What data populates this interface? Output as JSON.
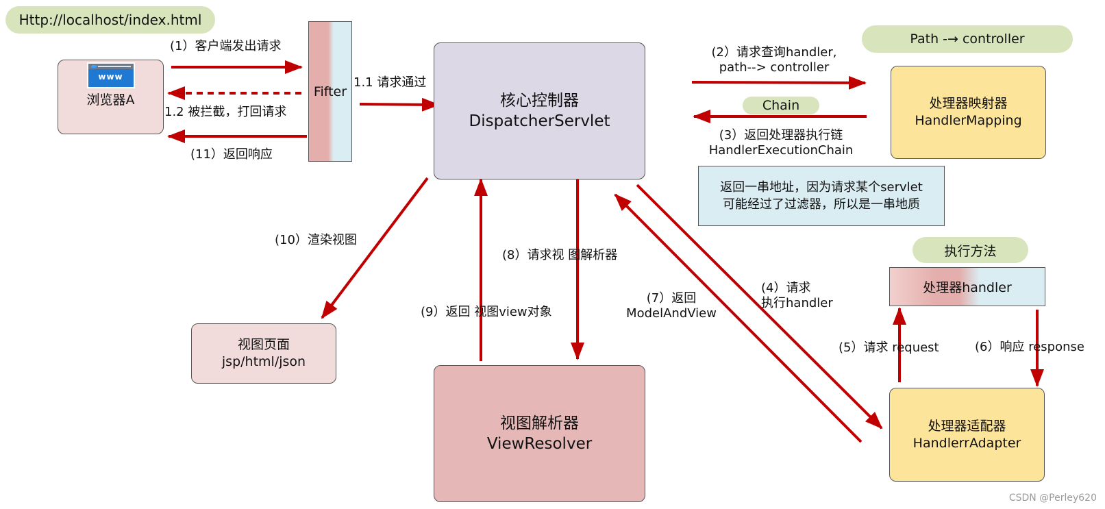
{
  "url_pill": "Http://localhost/index.html",
  "browser": {
    "label": "浏览器A",
    "icon_text": "www"
  },
  "filter": {
    "label": "Fifter"
  },
  "dispatcher": {
    "line1": "核心控制器",
    "line2": "DispatcherServlet"
  },
  "handler_mapping": {
    "line1": "处理器映射器",
    "line2": "HandlerMapping"
  },
  "path_pill": "Path -→ controller",
  "chain_pill": "Chain",
  "note": {
    "line1": "返回一串地址，因为请求某个servlet",
    "line2": "可能经过了过滤器，所以是一串地质"
  },
  "exec_pill": "执行方法",
  "handler": {
    "label": "处理器handler"
  },
  "adapter": {
    "line1": "处理器适配器",
    "line2": "HandlerrAdapter"
  },
  "view_page": {
    "line1": "视图页面",
    "line2": "jsp/html/json"
  },
  "view_resolver": {
    "line1": "视图解析器",
    "line2": "ViewResolver"
  },
  "steps": {
    "s1": "(1）客户端发出请求",
    "s1_2": "1.2 被拦截，打回请求",
    "s11": "(11）返回响应",
    "s1_1": "1.1 请求通过",
    "s2a": "(2）请求查询handler,",
    "s2b": "path--> controller",
    "s3a": "(3）返回处理器执行链",
    "s3b": "HandlerExecutionChain",
    "s4a": "(4）请求",
    "s4b": "执行handler",
    "s5": "(5）请求 request",
    "s6": "(6）响应 response",
    "s7a": "(7）返回",
    "s7b": "ModelAndView",
    "s8": "(8）请求视 图解析器",
    "s9": "(9）返回 视图view对象",
    "s10": "(10）渲染视图"
  },
  "watermark": "CSDN @Perley620",
  "colors": {
    "arrow": "#c00000",
    "pill": "#d8e4bc",
    "dispatcher": "#ddd8e6",
    "mapping": "#fde49b",
    "note": "#daedf3",
    "resolver": "#e5b8b7",
    "viewpage": "#f2dcdb"
  }
}
